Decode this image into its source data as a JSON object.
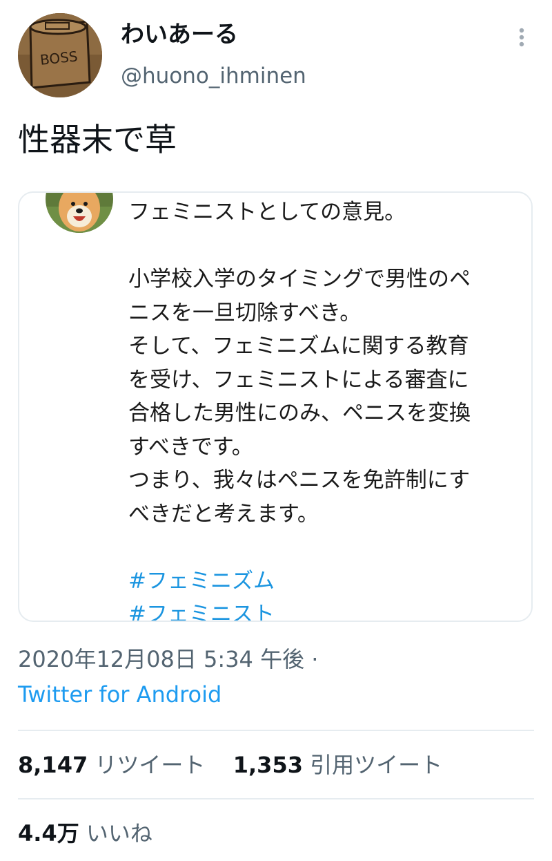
{
  "author": {
    "display_name": "わいあーる",
    "handle": "@huono_ihminen",
    "avatar_text": "BOSS",
    "avatar_icon": "coffee-can-icon"
  },
  "tweet": {
    "text": "性器末で草"
  },
  "quoted_screenshot": {
    "avatar_icon": "dog-avatar-icon",
    "lines": [
      "フェミニストとしての意見。",
      "",
      "小学校入学のタイミングで男性のペ",
      "ニスを一旦切除すべき。",
      "そして、フェミニズムに関する教育",
      "を受け、フェミニストによる審査に",
      "合格した男性にのみ、ペニスを変換",
      "すべきです。",
      "つまり、我々はペニスを免許制にす",
      "べきだと考えます。",
      ""
    ],
    "hashtags": [
      "#フェミニズム",
      "#フェミニスト"
    ]
  },
  "meta": {
    "timestamp": "2020年12月08日 5:34 午後 ·",
    "source": "Twitter for Android"
  },
  "stats": {
    "retweets_count": "8,147",
    "retweets_label": "リツイート",
    "quotes_count": "1,353",
    "quotes_label": "引用ツイート",
    "likes_count": "4.4万",
    "likes_label": "いいね"
  },
  "colors": {
    "accent": "#1d9bf0",
    "hashtag": "#1b95e0",
    "secondary_text": "#536471",
    "divider": "#e6ecf0"
  }
}
